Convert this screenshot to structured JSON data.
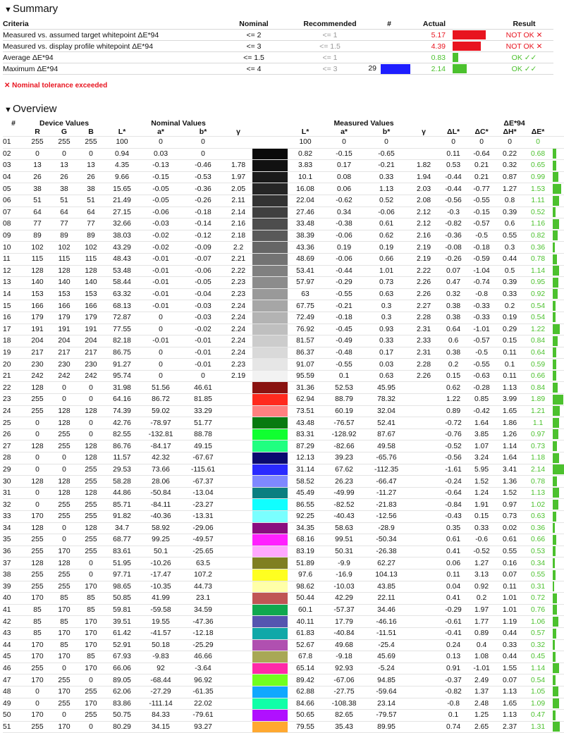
{
  "summary": {
    "title": "Summary",
    "headers": {
      "criteria": "Criteria",
      "nominal": "Nominal",
      "recommended": "Recommended",
      "hash": "#",
      "actual": "Actual",
      "result": "Result"
    },
    "rows": [
      {
        "criteria": "Measured vs. assumed target whitepoint ΔE*94",
        "nominal": "<= 2",
        "recommended": "<= 1",
        "num": "",
        "actual": "5.17",
        "actual_color": "#e8141f",
        "bar_color": "#e8141f",
        "bar_fraction": 0.55,
        "result": "NOT OK ✕",
        "result_color": "#e8141f"
      },
      {
        "criteria": "Measured vs. display profile whitepoint ΔE*94",
        "nominal": "<= 3",
        "recommended": "<= 1.5",
        "num": "",
        "actual": "4.39",
        "actual_color": "#e8141f",
        "bar_color": "#e8141f",
        "bar_fraction": 0.47,
        "result": "NOT OK ✕",
        "result_color": "#e8141f"
      },
      {
        "criteria": "Average ΔE*94",
        "nominal": "<= 1.5",
        "recommended": "<= 1",
        "num": "",
        "actual": "0.83",
        "actual_color": "#4cc12e",
        "bar_color": "#4cc12e",
        "bar_fraction": 0.09,
        "result": "OK ✓✓",
        "result_color": "#4cc12e"
      },
      {
        "criteria": "Maximum ΔE*94",
        "nominal": "<= 4",
        "recommended": "<= 3",
        "num": "29",
        "num_swatch": "#1e1eff",
        "actual": "2.14",
        "actual_color": "#4cc12e",
        "bar_color": "#4cc12e",
        "bar_fraction": 0.23,
        "result": "OK ✓✓",
        "result_color": "#4cc12e"
      }
    ],
    "warning": "✕ Nominal tolerance exceeded"
  },
  "overview": {
    "title": "Overview",
    "group_headers": {
      "num": "#",
      "device": "Device Values",
      "nominal": "Nominal Values",
      "measured": "Measured Values",
      "de": "ΔE*94"
    },
    "sub_headers": [
      "R",
      "G",
      "B",
      "L*",
      "a*",
      "b*",
      "γ",
      "L*",
      "a*",
      "b*",
      "γ",
      "ΔL*",
      "ΔC*",
      "ΔH*",
      "ΔE*"
    ],
    "rows": [
      [
        "01",
        "255",
        "255",
        "255",
        "100",
        "0",
        "0",
        "",
        "#ffffff",
        "100",
        "0",
        "0",
        "",
        "0",
        "0",
        "0",
        "0"
      ],
      [
        "02",
        "0",
        "0",
        "0",
        "0.94",
        "0.03",
        "0",
        "",
        "#0a0a0a",
        "0.82",
        "-0.15",
        "-0.65",
        "",
        "0.11",
        "-0.64",
        "0.22",
        "0.68"
      ],
      [
        "03",
        "13",
        "13",
        "13",
        "4.35",
        "-0.13",
        "-0.46",
        "1.78",
        "#111111",
        "3.83",
        "0.17",
        "-0.21",
        "1.82",
        "0.53",
        "0.21",
        "0.32",
        "0.65"
      ],
      [
        "04",
        "26",
        "26",
        "26",
        "9.66",
        "-0.15",
        "-0.53",
        "1.97",
        "#1a1a1a",
        "10.1",
        "0.08",
        "0.33",
        "1.94",
        "-0.44",
        "0.21",
        "0.87",
        "0.99"
      ],
      [
        "05",
        "38",
        "38",
        "38",
        "15.65",
        "-0.05",
        "-0.36",
        "2.05",
        "#262626",
        "16.08",
        "0.06",
        "1.13",
        "2.03",
        "-0.44",
        "-0.77",
        "1.27",
        "1.53"
      ],
      [
        "06",
        "51",
        "51",
        "51",
        "21.49",
        "-0.05",
        "-0.26",
        "2.11",
        "#333333",
        "22.04",
        "-0.62",
        "0.52",
        "2.08",
        "-0.56",
        "-0.55",
        "0.8",
        "1.11"
      ],
      [
        "07",
        "64",
        "64",
        "64",
        "27.15",
        "-0.06",
        "-0.18",
        "2.14",
        "#404040",
        "27.46",
        "0.34",
        "-0.06",
        "2.12",
        "-0.3",
        "-0.15",
        "0.39",
        "0.52"
      ],
      [
        "08",
        "77",
        "77",
        "77",
        "32.66",
        "-0.03",
        "-0.14",
        "2.16",
        "#4d4d4d",
        "33.48",
        "-0.38",
        "0.61",
        "2.12",
        "-0.82",
        "-0.57",
        "0.6",
        "1.16"
      ],
      [
        "09",
        "89",
        "89",
        "89",
        "38.03",
        "-0.02",
        "-0.12",
        "2.18",
        "#595959",
        "38.39",
        "-0.06",
        "0.62",
        "2.16",
        "-0.36",
        "-0.5",
        "0.55",
        "0.82"
      ],
      [
        "10",
        "102",
        "102",
        "102",
        "43.29",
        "-0.02",
        "-0.09",
        "2.2",
        "#666666",
        "43.36",
        "0.19",
        "0.19",
        "2.19",
        "-0.08",
        "-0.18",
        "0.3",
        "0.36"
      ],
      [
        "11",
        "115",
        "115",
        "115",
        "48.43",
        "-0.01",
        "-0.07",
        "2.21",
        "#737373",
        "48.69",
        "-0.06",
        "0.66",
        "2.19",
        "-0.26",
        "-0.59",
        "0.44",
        "0.78"
      ],
      [
        "12",
        "128",
        "128",
        "128",
        "53.48",
        "-0.01",
        "-0.06",
        "2.22",
        "#808080",
        "53.41",
        "-0.44",
        "1.01",
        "2.22",
        "0.07",
        "-1.04",
        "0.5",
        "1.14"
      ],
      [
        "13",
        "140",
        "140",
        "140",
        "58.44",
        "-0.01",
        "-0.05",
        "2.23",
        "#8c8c8c",
        "57.97",
        "-0.29",
        "0.73",
        "2.26",
        "0.47",
        "-0.74",
        "0.39",
        "0.95"
      ],
      [
        "14",
        "153",
        "153",
        "153",
        "63.32",
        "-0.01",
        "-0.04",
        "2.23",
        "#999999",
        "63",
        "-0.55",
        "0.63",
        "2.26",
        "0.32",
        "-0.8",
        "0.33",
        "0.92"
      ],
      [
        "15",
        "166",
        "166",
        "166",
        "68.13",
        "-0.01",
        "-0.03",
        "2.24",
        "#a6a6a6",
        "67.75",
        "-0.21",
        "0.3",
        "2.27",
        "0.38",
        "-0.33",
        "0.2",
        "0.54"
      ],
      [
        "16",
        "179",
        "179",
        "179",
        "72.87",
        "0",
        "-0.03",
        "2.24",
        "#b3b3b3",
        "72.49",
        "-0.18",
        "0.3",
        "2.28",
        "0.38",
        "-0.33",
        "0.19",
        "0.54"
      ],
      [
        "17",
        "191",
        "191",
        "191",
        "77.55",
        "0",
        "-0.02",
        "2.24",
        "#bfbfbf",
        "76.92",
        "-0.45",
        "0.93",
        "2.31",
        "0.64",
        "-1.01",
        "0.29",
        "1.22"
      ],
      [
        "18",
        "204",
        "204",
        "204",
        "82.18",
        "-0.01",
        "-0.01",
        "2.24",
        "#cccccc",
        "81.57",
        "-0.49",
        "0.33",
        "2.33",
        "0.6",
        "-0.57",
        "0.15",
        "0.84"
      ],
      [
        "19",
        "217",
        "217",
        "217",
        "86.75",
        "0",
        "-0.01",
        "2.24",
        "#d9d9d9",
        "86.37",
        "-0.48",
        "0.17",
        "2.31",
        "0.38",
        "-0.5",
        "0.11",
        "0.64"
      ],
      [
        "20",
        "230",
        "230",
        "230",
        "91.27",
        "0",
        "-0.01",
        "2.23",
        "#e6e6e6",
        "91.07",
        "-0.55",
        "0.03",
        "2.28",
        "0.2",
        "-0.55",
        "0.1",
        "0.59"
      ],
      [
        "21",
        "242",
        "242",
        "242",
        "95.74",
        "0",
        "0",
        "2.19",
        "#f2f2f2",
        "95.59",
        "0.1",
        "0.63",
        "2.26",
        "0.15",
        "-0.63",
        "0.11",
        "0.66"
      ],
      [
        "22",
        "128",
        "0",
        "0",
        "31.98",
        "51.56",
        "46.61",
        "",
        "#8a1210",
        "31.36",
        "52.53",
        "45.95",
        "",
        "0.62",
        "-0.28",
        "1.13",
        "0.84"
      ],
      [
        "23",
        "255",
        "0",
        "0",
        "64.16",
        "86.72",
        "81.85",
        "",
        "#ff2a1e",
        "62.94",
        "88.79",
        "78.32",
        "",
        "1.22",
        "0.85",
        "3.99",
        "1.89"
      ],
      [
        "24",
        "255",
        "128",
        "128",
        "74.39",
        "59.02",
        "33.29",
        "",
        "#ff8080",
        "73.51",
        "60.19",
        "32.04",
        "",
        "0.89",
        "-0.42",
        "1.65",
        "1.21"
      ],
      [
        "25",
        "0",
        "128",
        "0",
        "42.76",
        "-78.97",
        "51.77",
        "",
        "#087a10",
        "43.48",
        "-76.57",
        "52.41",
        "",
        "-0.72",
        "1.64",
        "1.86",
        "1.1"
      ],
      [
        "26",
        "0",
        "255",
        "0",
        "82.55",
        "-132.81",
        "88.78",
        "",
        "#10ff30",
        "83.31",
        "-128.92",
        "87.67",
        "",
        "-0.76",
        "3.85",
        "1.26",
        "0.97"
      ],
      [
        "27",
        "128",
        "255",
        "128",
        "86.76",
        "-84.17",
        "49.15",
        "",
        "#20ff80",
        "87.29",
        "-82.66",
        "49.58",
        "",
        "-0.52",
        "1.07",
        "1.14",
        "0.73"
      ],
      [
        "28",
        "0",
        "0",
        "128",
        "11.57",
        "42.32",
        "-67.67",
        "",
        "#0a0a70",
        "12.13",
        "39.23",
        "-65.76",
        "",
        "-0.56",
        "3.24",
        "1.64",
        "1.18"
      ],
      [
        "29",
        "0",
        "0",
        "255",
        "29.53",
        "73.66",
        "-115.61",
        "",
        "#2a2aff",
        "31.14",
        "67.62",
        "-112.35",
        "",
        "-1.61",
        "5.95",
        "3.41",
        "2.14"
      ],
      [
        "30",
        "128",
        "128",
        "255",
        "58.28",
        "28.06",
        "-67.37",
        "",
        "#7f88ff",
        "58.52",
        "26.23",
        "-66.47",
        "",
        "-0.24",
        "1.52",
        "1.36",
        "0.78"
      ],
      [
        "31",
        "0",
        "128",
        "128",
        "44.86",
        "-50.84",
        "-13.04",
        "",
        "#0a7f80",
        "45.49",
        "-49.99",
        "-11.27",
        "",
        "-0.64",
        "1.24",
        "1.52",
        "1.13"
      ],
      [
        "32",
        "0",
        "255",
        "255",
        "85.71",
        "-84.11",
        "-23.27",
        "",
        "#10ffff",
        "86.55",
        "-82.52",
        "-21.83",
        "",
        "-0.84",
        "1.91",
        "0.97",
        "1.02"
      ],
      [
        "33",
        "170",
        "255",
        "255",
        "91.82",
        "-40.36",
        "-13.31",
        "",
        "#7affff",
        "92.25",
        "-40.43",
        "-12.56",
        "",
        "-0.43",
        "0.15",
        "0.73",
        "0.63"
      ],
      [
        "34",
        "128",
        "0",
        "128",
        "34.7",
        "58.92",
        "-29.06",
        "",
        "#8a0e80",
        "34.35",
        "58.63",
        "-28.9",
        "",
        "0.35",
        "0.33",
        "0.02",
        "0.36"
      ],
      [
        "35",
        "255",
        "0",
        "255",
        "68.77",
        "99.25",
        "-49.57",
        "",
        "#ff20ff",
        "68.16",
        "99.51",
        "-50.34",
        "",
        "0.61",
        "-0.6",
        "0.61",
        "0.66"
      ],
      [
        "36",
        "255",
        "170",
        "255",
        "83.61",
        "50.1",
        "-25.65",
        "",
        "#ffa8ff",
        "83.19",
        "50.31",
        "-26.38",
        "",
        "0.41",
        "-0.52",
        "0.55",
        "0.53"
      ],
      [
        "37",
        "128",
        "128",
        "0",
        "51.95",
        "-10.26",
        "63.5",
        "",
        "#7f7f20",
        "51.89",
        "-9.9",
        "62.27",
        "",
        "0.06",
        "1.27",
        "0.16",
        "0.34"
      ],
      [
        "38",
        "255",
        "255",
        "0",
        "97.71",
        "-17.47",
        "107.2",
        "",
        "#ffff20",
        "97.6",
        "-16.9",
        "104.13",
        "",
        "0.11",
        "3.13",
        "0.07",
        "0.55"
      ],
      [
        "39",
        "255",
        "255",
        "170",
        "98.65",
        "-10.35",
        "44.73",
        "",
        "#ffffa8",
        "98.62",
        "-10.03",
        "43.85",
        "",
        "0.04",
        "0.92",
        "0.11",
        "0.31"
      ],
      [
        "40",
        "170",
        "85",
        "85",
        "50.85",
        "41.99",
        "23.1",
        "",
        "#c05555",
        "50.44",
        "42.29",
        "22.11",
        "",
        "0.41",
        "0.2",
        "1.01",
        "0.72"
      ],
      [
        "41",
        "85",
        "170",
        "85",
        "59.81",
        "-59.58",
        "34.59",
        "",
        "#10a84f",
        "60.1",
        "-57.37",
        "34.46",
        "",
        "-0.29",
        "1.97",
        "1.01",
        "0.76"
      ],
      [
        "42",
        "85",
        "85",
        "170",
        "39.51",
        "19.55",
        "-47.36",
        "",
        "#5555b0",
        "40.11",
        "17.79",
        "-46.16",
        "",
        "-0.61",
        "1.77",
        "1.19",
        "1.06"
      ],
      [
        "43",
        "85",
        "170",
        "170",
        "61.42",
        "-41.57",
        "-12.18",
        "",
        "#10a8a8",
        "61.83",
        "-40.84",
        "-11.51",
        "",
        "-0.41",
        "0.89",
        "0.44",
        "0.57"
      ],
      [
        "44",
        "170",
        "85",
        "170",
        "52.91",
        "50.18",
        "-25.29",
        "",
        "#b050b0",
        "52.67",
        "49.68",
        "-25.4",
        "",
        "0.24",
        "0.4",
        "0.33",
        "0.32"
      ],
      [
        "45",
        "170",
        "170",
        "85",
        "67.93",
        "-9.83",
        "46.66",
        "",
        "#a8a855",
        "67.8",
        "-9.18",
        "45.69",
        "",
        "0.13",
        "1.08",
        "0.44",
        "0.45"
      ],
      [
        "46",
        "255",
        "0",
        "170",
        "66.06",
        "92",
        "-3.64",
        "",
        "#ff2aa8",
        "65.14",
        "92.93",
        "-5.24",
        "",
        "0.91",
        "-1.01",
        "1.55",
        "1.14"
      ],
      [
        "47",
        "170",
        "255",
        "0",
        "89.05",
        "-68.44",
        "96.92",
        "",
        "#70ff20",
        "89.42",
        "-67.06",
        "94.85",
        "",
        "-0.37",
        "2.49",
        "0.07",
        "0.54"
      ],
      [
        "48",
        "0",
        "170",
        "255",
        "62.06",
        "-27.29",
        "-61.35",
        "",
        "#10a8ff",
        "62.88",
        "-27.75",
        "-59.64",
        "",
        "-0.82",
        "1.37",
        "1.13",
        "1.05"
      ],
      [
        "49",
        "0",
        "255",
        "170",
        "83.86",
        "-111.14",
        "22.02",
        "",
        "#10ffa8",
        "84.66",
        "-108.38",
        "23.14",
        "",
        "-0.8",
        "2.48",
        "1.65",
        "1.09"
      ],
      [
        "50",
        "170",
        "0",
        "255",
        "50.75",
        "84.33",
        "-79.61",
        "",
        "#b010ff",
        "50.65",
        "82.65",
        "-79.57",
        "",
        "0.1",
        "1.25",
        "1.13",
        "0.47"
      ],
      [
        "51",
        "255",
        "170",
        "0",
        "80.29",
        "34.15",
        "93.27",
        "",
        "#ffa830",
        "79.55",
        "35.43",
        "89.95",
        "",
        "0.74",
        "2.65",
        "2.37",
        "1.31"
      ]
    ]
  }
}
